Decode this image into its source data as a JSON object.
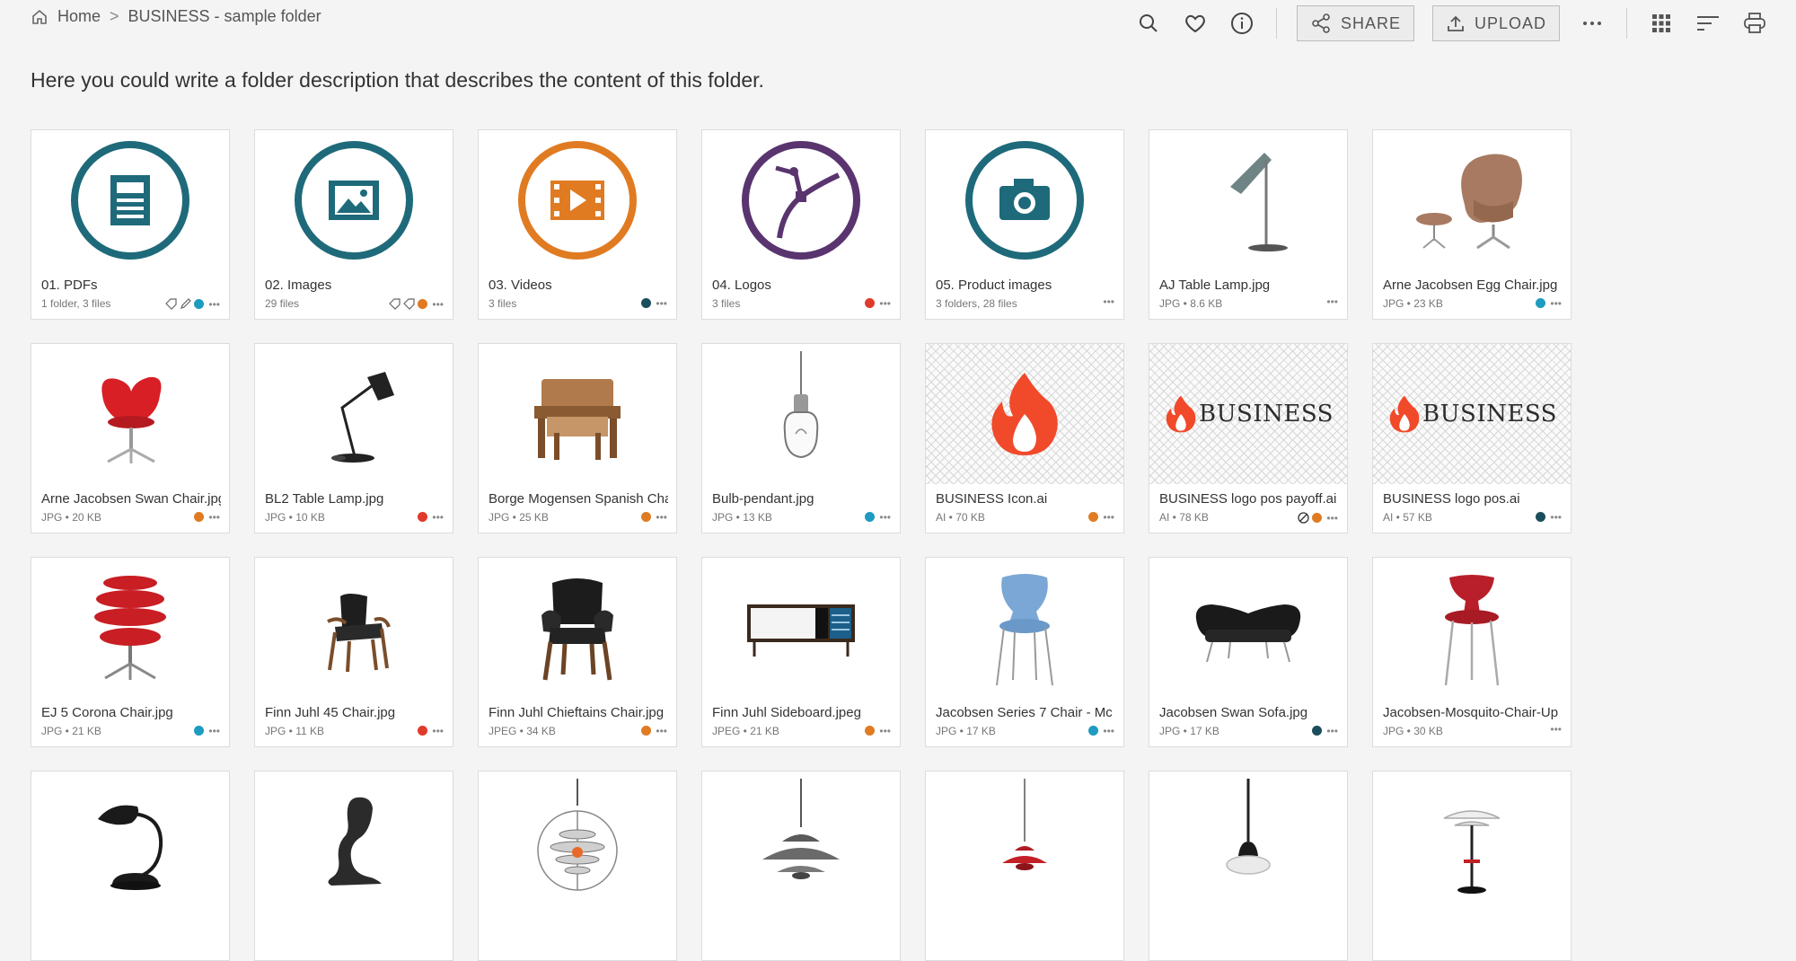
{
  "breadcrumb": {
    "home": "Home",
    "folder": "BUSINESS - sample folder"
  },
  "toolbar": {
    "share": "SHARE",
    "upload": "UPLOAD"
  },
  "description": "Here you could write a folder description that describes the content of this folder.",
  "colors": {
    "teal": "#1e6a7a",
    "orange": "#e07b22",
    "purple": "#59346f",
    "red": "#e03a2a",
    "navy": "#1b4e5c",
    "dot_blue": "#1d9bc0"
  },
  "cards": [
    {
      "name": "01. PDFs",
      "meta": "1 folder, 3 files",
      "thumb": "pdf-folder-icon",
      "dot": "#1d9bc0"
    },
    {
      "name": "02. Images",
      "meta": "29 files",
      "thumb": "image-folder-icon",
      "dot": "#e07b22"
    },
    {
      "name": "03. Videos",
      "meta": "3 files",
      "thumb": "video-folder-icon",
      "dot": "#1b4e5c"
    },
    {
      "name": "04. Logos",
      "meta": "3 files",
      "thumb": "logo-folder-icon",
      "dot": "#e03a2a"
    },
    {
      "name": "05. Product images",
      "meta": "3 folders, 28 files",
      "thumb": "camera-folder-icon",
      "dot": ""
    },
    {
      "name": "AJ Table Lamp.jpg",
      "meta": "JPG • 8.6 KB",
      "thumb": "table-lamp",
      "dot": ""
    },
    {
      "name": "Arne Jacobsen Egg Chair.jpg",
      "meta": "JPG • 23 KB",
      "thumb": "egg-chair",
      "dot": "#1d9bc0"
    },
    {
      "name": "Arne Jacobsen Swan Chair.jpg",
      "meta": "JPG • 20 KB",
      "thumb": "swan-chair",
      "dot": "#e07b22"
    },
    {
      "name": "BL2 Table Lamp.jpg",
      "meta": "JPG • 10 KB",
      "thumb": "desk-lamp",
      "dot": "#e03a2a"
    },
    {
      "name": "Borge Mogensen Spanish Chair.jpg",
      "meta": "JPG • 25 KB",
      "thumb": "spanish-chair",
      "dot": "#e07b22"
    },
    {
      "name": "Bulb-pendant.jpg",
      "meta": "JPG • 13 KB",
      "thumb": "bulb-pendant",
      "dot": "#1d9bc0"
    },
    {
      "name": "BUSINESS Icon.ai",
      "meta": "AI • 70 KB",
      "thumb": "business-flame",
      "dot": "#e07b22"
    },
    {
      "name": "BUSINESS logo pos payoff.ai",
      "meta": "AI • 78 KB",
      "thumb": "business-logo-payoff",
      "dot": "#e07b22"
    },
    {
      "name": "BUSINESS logo pos.ai",
      "meta": "AI • 57 KB",
      "thumb": "business-logo",
      "dot": "#1b4e5c"
    },
    {
      "name": "EJ 5 Corona Chair.jpg",
      "meta": "JPG • 21 KB",
      "thumb": "corona-chair",
      "dot": "#1d9bc0"
    },
    {
      "name": "Finn Juhl 45 Chair.jpg",
      "meta": "JPG • 11 KB",
      "thumb": "juhl-45-chair",
      "dot": "#e03a2a"
    },
    {
      "name": "Finn Juhl Chieftains Chair.jpg",
      "meta": "JPEG • 34 KB",
      "thumb": "chieftain-chair",
      "dot": "#e07b22"
    },
    {
      "name": "Finn Juhl Sideboard.jpeg",
      "meta": "JPEG • 21 KB",
      "thumb": "sideboard",
      "dot": "#e07b22"
    },
    {
      "name": "Jacobsen Series 7 Chair - Mc",
      "meta": "JPG • 17 KB",
      "thumb": "series7-chair",
      "dot": "#1d9bc0"
    },
    {
      "name": "Jacobsen Swan Sofa.jpg",
      "meta": "JPG • 17 KB",
      "thumb": "swan-sofa",
      "dot": "#1b4e5c"
    },
    {
      "name": "Jacobsen-Mosquito-Chair-Up",
      "meta": "JPG • 30 KB",
      "thumb": "mosquito-chair",
      "dot": ""
    },
    {
      "name": "",
      "meta": "",
      "thumb": "kaiser-lamp",
      "dot": ""
    },
    {
      "name": "",
      "meta": "",
      "thumb": "panton-chair",
      "dot": ""
    },
    {
      "name": "",
      "meta": "",
      "thumb": "globe-pendant",
      "dot": ""
    },
    {
      "name": "",
      "meta": "",
      "thumb": "ph5-pendant",
      "dot": ""
    },
    {
      "name": "",
      "meta": "",
      "thumb": "red-pendant",
      "dot": ""
    },
    {
      "name": "",
      "meta": "",
      "thumb": "white-pendant",
      "dot": ""
    },
    {
      "name": "",
      "meta": "",
      "thumb": "floor-lamp",
      "dot": ""
    }
  ]
}
